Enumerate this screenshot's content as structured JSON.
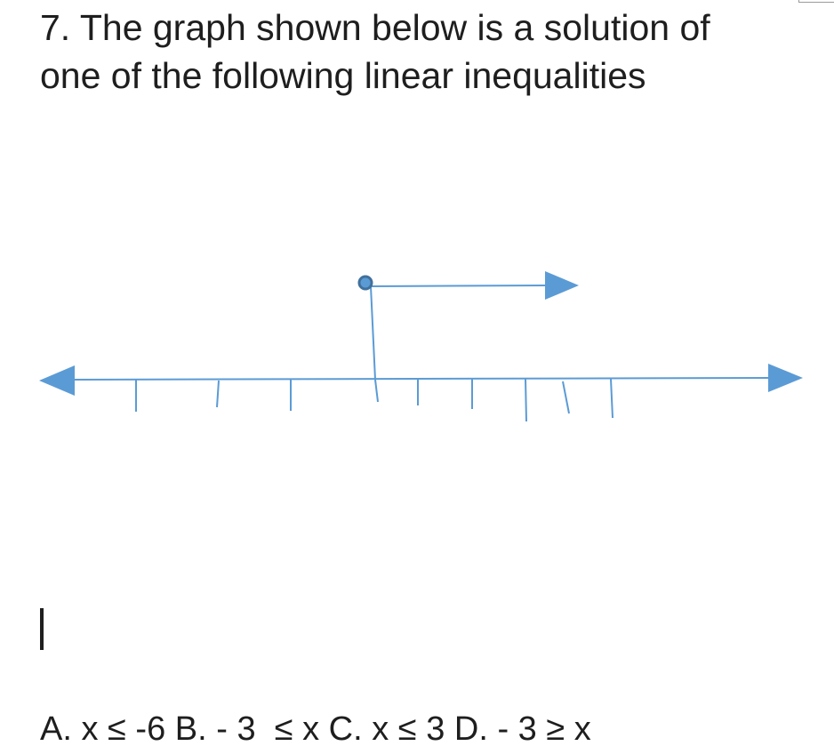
{
  "question": {
    "text": "7. The graph shown below is a solution of\none of the following linear inequalities"
  },
  "choices": {
    "text": "A. x ≤ -6 B. - 3  ≤ x C. x ≤ 3 D. - 3 ≥ x"
  },
  "number_line": {
    "stroke_color": "#5b9bd5",
    "point_fill": "#5b9bd5",
    "point_stroke": "#41719c",
    "closed_point": true,
    "direction": "right"
  }
}
